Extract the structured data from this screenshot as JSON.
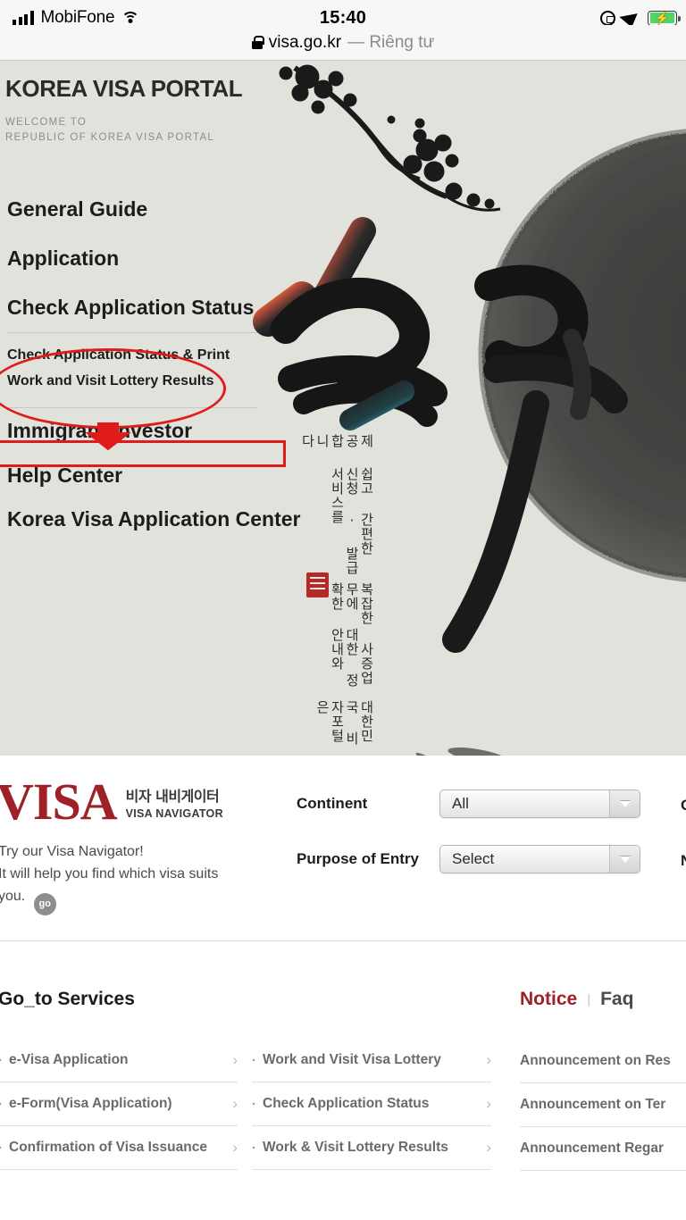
{
  "status_bar": {
    "carrier": "MobiFone",
    "time": "15:40",
    "icons": [
      "signal-bars-icon",
      "wifi-icon",
      "rotation-lock-icon",
      "location-arrow-icon",
      "battery-charging-icon"
    ]
  },
  "url_bar": {
    "lock_icon": "padlock-icon",
    "host": "visa.go.kr",
    "privacy_label": "— Riêng tư"
  },
  "hero": {
    "brand_title": "KOREA VISA PORTAL",
    "brand_sub_line1": "WELCOME TO",
    "brand_sub_line2": "REPUBLIC OF KOREA VISA PORTAL",
    "calligraphy": "한국",
    "vertical_text": [
      "대한민국 비자포털은",
      "복잡한 사증업무에 대한 정확한 안내와",
      "쉽고 간편한 신청 · 발급 서비스를",
      "제공합니다"
    ],
    "nav": [
      {
        "label": "General Guide"
      },
      {
        "label": "Application"
      },
      {
        "label": "Check Application Status"
      },
      {
        "label": "Immigrant Investor"
      },
      {
        "label": "Help Center"
      },
      {
        "label": "Korea Visa Application Center"
      }
    ],
    "sub_nav": [
      {
        "label": "Check Application Status & Print"
      },
      {
        "label": "Work and Visit Lottery Results"
      }
    ],
    "annotation_color": "#e01b1b"
  },
  "navigator": {
    "logo_word": "VISA",
    "logo_kr_top": "비자 내비게이터",
    "logo_kr_bottom": "VISA NAVIGATOR",
    "blurb_line1": "Try our Visa Navigator!",
    "blurb_line2": "It will help you find which visa suits",
    "blurb_line3": "you.",
    "go_label": "go",
    "fields": [
      {
        "label": "Continent",
        "value": "All",
        "cut_right": "C"
      },
      {
        "label": "Purpose of Entry",
        "value": "Select",
        "cut_right": "N"
      }
    ]
  },
  "services": {
    "title": "Go_to Services",
    "column1": [
      "e-Visa Application",
      "e-Form(Visa Application)",
      "Confirmation of Visa Issuance"
    ],
    "column2": [
      "Work and Visit Visa Lottery",
      "Check Application Status",
      "Work & Visit Lottery Results"
    ],
    "bullet": "·",
    "chevron": "›"
  },
  "notices": {
    "tab_notice": "Notice",
    "tab_separator": "|",
    "tab_faq": "Faq",
    "items": [
      "Announcement on Res",
      "Announcement on Ter",
      "Announcement Regar"
    ]
  },
  "colors": {
    "hero_bg": "#e2e2dd",
    "brand_red": "#9e2128",
    "annotation_red": "#e01b1b",
    "battery_green": "#4cd662"
  }
}
